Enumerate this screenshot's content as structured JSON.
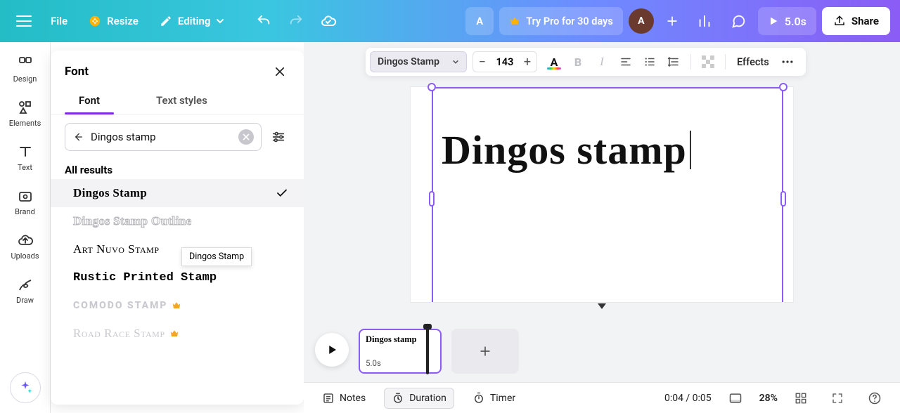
{
  "topbar": {
    "file": "File",
    "resize": "Resize",
    "editing": "Editing",
    "a_toggle": "A",
    "try_pro": "Try Pro for 30 days",
    "avatar_initial": "A",
    "play_duration": "5.0s",
    "share": "Share"
  },
  "rail": {
    "design": "Design",
    "elements": "Elements",
    "text": "Text",
    "brand": "Brand",
    "uploads": "Uploads",
    "draw": "Draw"
  },
  "panel": {
    "title": "Font",
    "tab_font": "Font",
    "tab_textstyles": "Text styles",
    "search_value": "Dingos stamp",
    "all_results": "All results",
    "fonts": [
      {
        "label": "Dingos Stamp",
        "cls": "fp-dingos",
        "selected": true,
        "premium": false
      },
      {
        "label": "Dingos Stamp Outline",
        "cls": "fp-outline",
        "selected": false,
        "premium": false
      },
      {
        "label": "Art Nuvo Stamp",
        "cls": "fp-artnuvo",
        "selected": false,
        "premium": false
      },
      {
        "label": "Rustic Printed Stamp",
        "cls": "fp-rustic",
        "selected": false,
        "premium": false
      },
      {
        "label": "COMODO STAMP",
        "cls": "fp-comodo",
        "selected": false,
        "premium": true
      },
      {
        "label": "Road Race Stamp",
        "cls": "fp-road",
        "selected": false,
        "premium": true
      }
    ],
    "tooltip": "Dingos Stamp"
  },
  "ctx": {
    "font_name": "Dingos Stamp",
    "size": "143",
    "effects": "Effects"
  },
  "canvas": {
    "text": "Dingos stamp"
  },
  "timeline": {
    "thumb_text": "Dingos stamp",
    "thumb_dur": "5.0s"
  },
  "bottombar": {
    "notes": "Notes",
    "duration": "Duration",
    "timer": "Timer",
    "time": "0:04 / 0:05",
    "zoom": "28%"
  }
}
